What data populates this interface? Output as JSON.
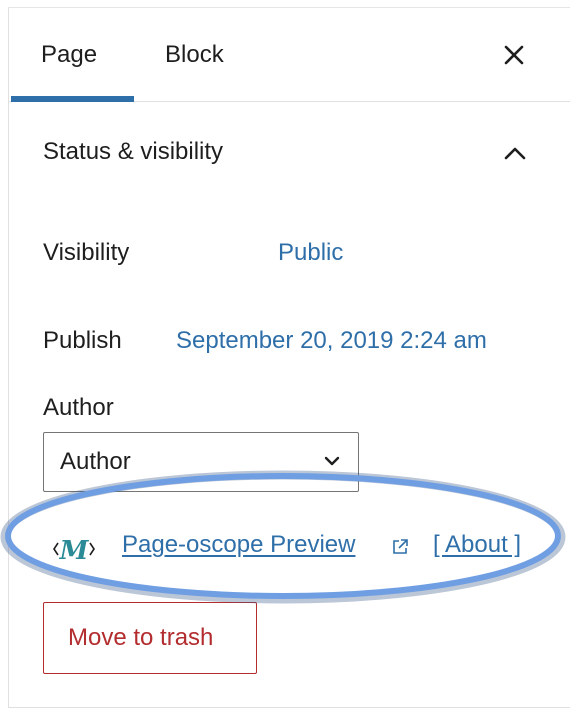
{
  "tabs": [
    {
      "label": "Page",
      "active": true
    },
    {
      "label": "Block",
      "active": false
    }
  ],
  "close_icon": "close-icon",
  "section": {
    "title": "Status & visibility",
    "expanded": true,
    "toggle_icon": "chevron-up-icon"
  },
  "visibility": {
    "label": "Visibility",
    "value": "Public"
  },
  "publish": {
    "label": "Publish",
    "value": "September 20, 2019 2:24 am"
  },
  "author": {
    "label": "Author",
    "selected": "Author",
    "dropdown_icon": "chevron-down-icon"
  },
  "plugin": {
    "logo_letter": "M",
    "logo_icon": "pageoscope-logo-icon",
    "link_label": "Page-oscope Preview",
    "external_icon": "external-link-icon",
    "about_label": "[ About ]"
  },
  "trash": {
    "label": "Move to trash"
  },
  "colors": {
    "accent": "#2f6fa9",
    "text": "#1e1e1e",
    "danger": "#b32d2e",
    "highlight_ring": "#6f9ee3",
    "logo_teal": "#2a8a96"
  }
}
